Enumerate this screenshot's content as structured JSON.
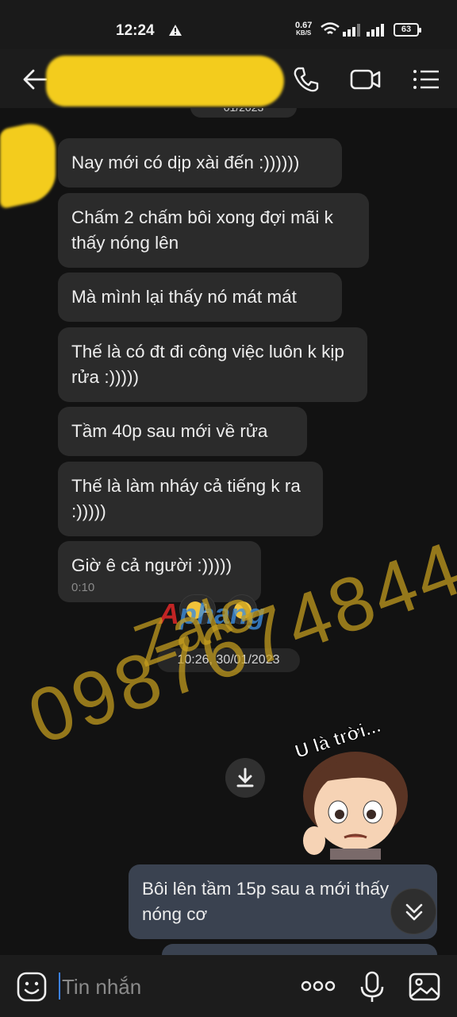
{
  "status_bar": {
    "time": "12:24",
    "speed_value": "0.67",
    "speed_unit": "KB/S",
    "battery": "63"
  },
  "header": {
    "back_icon": "arrow-left-icon",
    "call_icon": "phone-icon",
    "video_icon": "video-camera-icon",
    "menu_icon": "list-menu-icon"
  },
  "chat": {
    "top_date_partial": "01/2023",
    "messages": [
      {
        "text": "Nay mới có dịp xài đến :))))))"
      },
      {
        "text": "Chấm 2 chấm bôi xong đợi mãi k thấy nóng lên"
      },
      {
        "text": "Mà mình lại thấy nó mát mát"
      },
      {
        "text": "Thế là có đt đi công việc luôn k kịp rửa :)))))"
      },
      {
        "text": "Tầm 40p sau mới về rửa"
      },
      {
        "text": "Thế là làm nháy cả tiếng k ra :)))))"
      },
      {
        "text": "Giờ ê cả người :)))))",
        "time": "0:10"
      }
    ],
    "reaction_count": "1",
    "date_separator": "10:26, 30/01/2023",
    "sticker_caption": "U là trời...",
    "sent_message": "Bôi lên tầm 15p sau a mới thấy nóng cơ"
  },
  "watermark": {
    "zalo": "Zalo",
    "phone": "0987674844",
    "brand_first": "A",
    "brand_rest": "phang"
  },
  "input": {
    "placeholder": "Tin nhắn"
  },
  "colors": {
    "background": "#121212",
    "bubble_received": "#2b2b2b",
    "bubble_sent": "#3a4250",
    "accent": "#3b82f6",
    "redaction": "#f3cc1d"
  }
}
